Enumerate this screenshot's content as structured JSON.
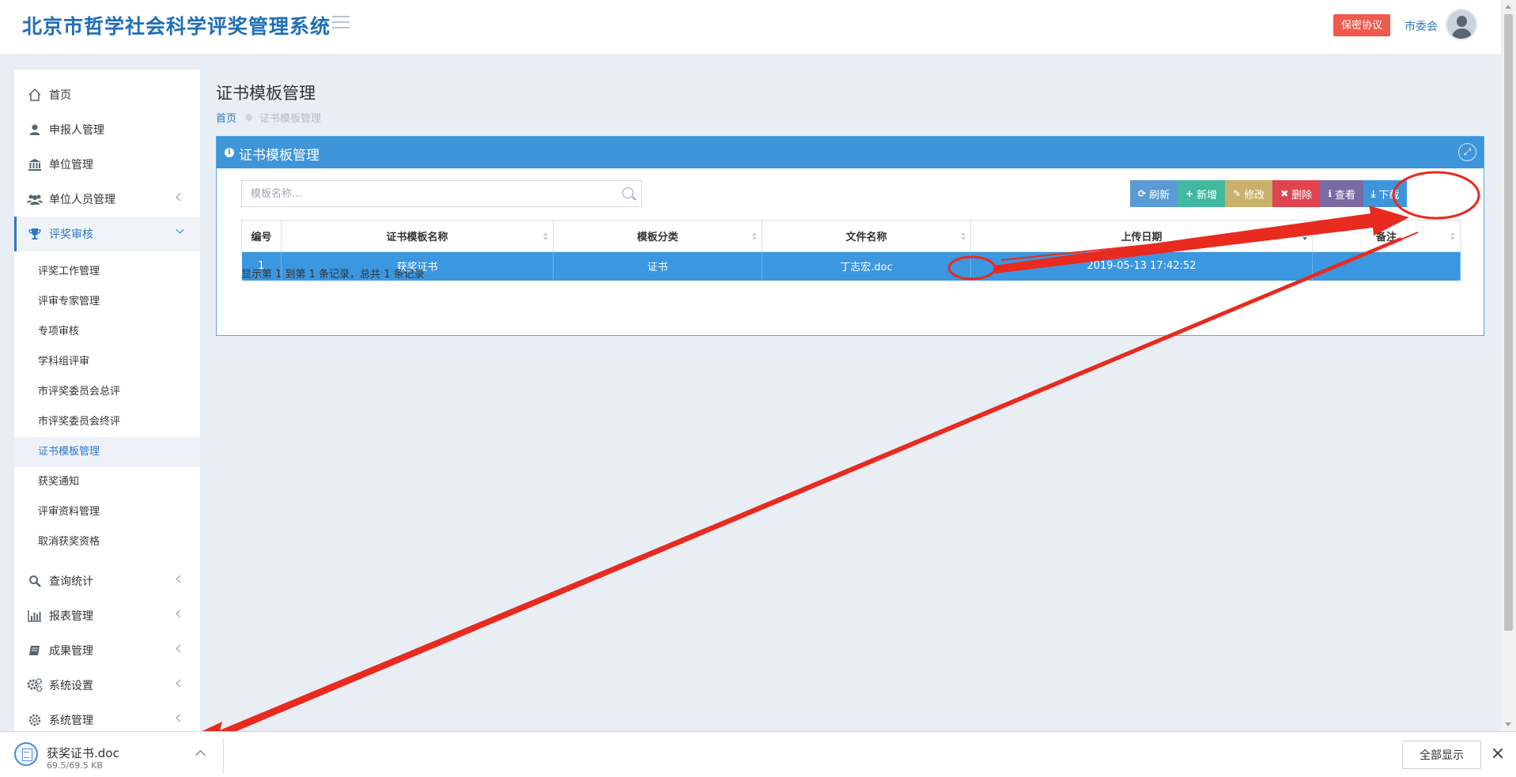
{
  "header": {
    "app_title": "北京市哲学社会科学评奖管理系统",
    "agreement_button": "保密协议",
    "user_name": "市委会"
  },
  "sidebar": {
    "items": [
      {
        "label": "首页",
        "icon": "home-icon"
      },
      {
        "label": "申报人管理",
        "icon": "user-icon"
      },
      {
        "label": "单位管理",
        "icon": "bank-icon"
      },
      {
        "label": "单位人员管理",
        "icon": "users-icon"
      },
      {
        "label": "评奖审核",
        "icon": "trophy-icon"
      },
      {
        "label": "查询统计",
        "icon": "search-icon"
      },
      {
        "label": "报表管理",
        "icon": "bar-chart-icon"
      },
      {
        "label": "成果管理",
        "icon": "book-icon"
      },
      {
        "label": "系统设置",
        "icon": "cogs-icon"
      },
      {
        "label": "系统管理",
        "icon": "gear-icon"
      }
    ],
    "sub_items": [
      "评奖工作管理",
      "评审专家管理",
      "专项审核",
      "学科组评审",
      "市评奖委员会总评",
      "市评奖委员会终评",
      "证书模板管理",
      "获奖通知",
      "评审资料管理",
      "取消获奖资格"
    ],
    "active_sub": "证书模板管理"
  },
  "page": {
    "title": "证书模板管理",
    "breadcrumb": {
      "home": "首页",
      "current": "证书模板管理"
    }
  },
  "panel": {
    "title": "证书模板管理",
    "search_placeholder": "模板名称...",
    "toolbar": [
      {
        "label": "刷新",
        "glyph": "⟳",
        "color": "#5b9bd5",
        "name": "refresh-button"
      },
      {
        "label": "新增",
        "glyph": "+",
        "color": "#42b8a1",
        "name": "add-button"
      },
      {
        "label": "修改",
        "glyph": "✎",
        "color": "#c9b06b",
        "name": "edit-button"
      },
      {
        "label": "删除",
        "glyph": "✖",
        "color": "#e0454f",
        "name": "delete-button"
      },
      {
        "label": "查看",
        "glyph": "ℹ",
        "color": "#7a6aa3",
        "name": "view-button"
      },
      {
        "label": "下载",
        "glyph": "⤓",
        "color": "#3f95d9",
        "name": "download-button"
      }
    ],
    "table": {
      "columns": [
        "编号",
        "证书模板名称",
        "模板分类",
        "文件名称",
        "上传日期",
        "备注"
      ],
      "rows": [
        [
          "1",
          "获奖证书",
          "证书",
          "丁志宏.doc",
          "2019-05-13 17:42:52",
          ""
        ]
      ],
      "selected_row": 0,
      "sort_column": "上传日期"
    },
    "pager_info": "显示第 1 到第 1 条记录，总共 1 条记录"
  },
  "download_bar": {
    "file_name": "获奖证书.doc",
    "file_size": "69.5/69.5 KB",
    "show_all": "全部显示"
  },
  "colors": {
    "brand": "#1e6fb7",
    "panel_header": "#3f95d9",
    "selected_row": "#3b97e0",
    "annotation_red": "#e82a1f"
  }
}
